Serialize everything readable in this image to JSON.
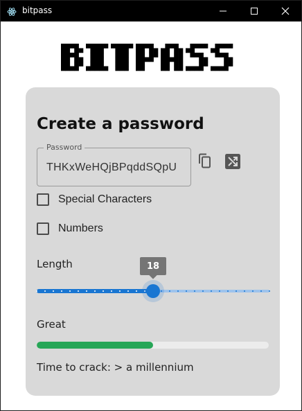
{
  "window": {
    "title": "bitpass",
    "icons": {
      "app": "electron-icon",
      "minimize": "minimize-icon",
      "maximize": "maximize-icon",
      "close": "close-icon"
    }
  },
  "logo": {
    "text": "BITPASS"
  },
  "generator": {
    "heading": "Create a password",
    "password_label": "Password",
    "password_value": "THKxWeHQjBPqddSQpU",
    "actions": {
      "copy_icon": "copy-icon",
      "shuffle_icon": "shuffle-icon"
    },
    "options": [
      {
        "label": "Special Characters",
        "checked": false
      },
      {
        "label": "Numbers",
        "checked": false
      }
    ],
    "length": {
      "label": "Length",
      "value": 18,
      "min": 4,
      "max": 32
    },
    "strength": {
      "label": "Great",
      "fraction": 0.5,
      "color": "#27a657"
    },
    "crack_time": "Time to crack: > a millennium"
  },
  "colors": {
    "accent": "#1976d2",
    "card": "#d9d9d9",
    "titlebar": "#000000"
  }
}
